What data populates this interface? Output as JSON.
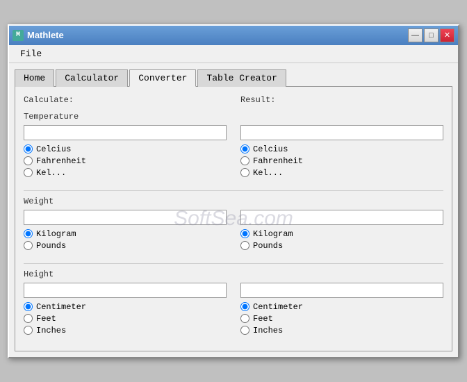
{
  "window": {
    "title": "Mathlete",
    "icon_label": "M"
  },
  "title_buttons": {
    "minimize": "—",
    "maximize": "□",
    "close": "✕"
  },
  "menu": {
    "items": [
      "File"
    ]
  },
  "tabs": {
    "items": [
      "Home",
      "Calculator",
      "Converter",
      "Table Creator"
    ],
    "active": "Converter"
  },
  "panel": {
    "calculate_label": "Calculate:",
    "result_label": "Result:",
    "watermark": "SoftSea.com",
    "temperature": {
      "label": "Temperature",
      "left_input": "",
      "right_input": "",
      "left_options": [
        "Celcius",
        "Fahrenheit",
        "Kel..."
      ],
      "right_options": [
        "Celcius",
        "Fahrenheit",
        "Kel..."
      ],
      "left_selected": "Celcius",
      "right_selected": "Celcius"
    },
    "weight": {
      "label": "Weight",
      "left_input": "",
      "right_input": "",
      "left_options": [
        "Kilogram",
        "Pounds"
      ],
      "right_options": [
        "Kilogram",
        "Pounds"
      ],
      "left_selected": "Kilogram",
      "right_selected": "Kilogram"
    },
    "height": {
      "label": "Height",
      "left_input": "",
      "right_input": "",
      "left_options": [
        "Centimeter",
        "Feet",
        "Inches"
      ],
      "right_options": [
        "Centimeter",
        "Feet",
        "Inches"
      ],
      "left_selected": "Centimeter",
      "right_selected": "Centimeter"
    }
  }
}
